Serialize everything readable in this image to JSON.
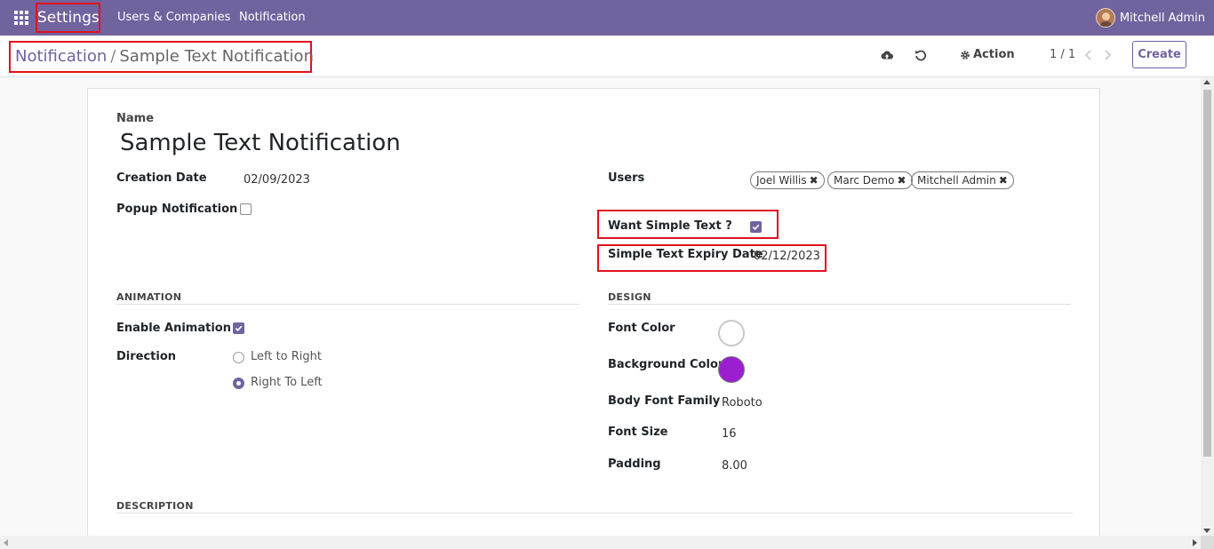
{
  "navbar": {
    "brand": "Settings",
    "menu": [
      "Users & Companies",
      "Notification"
    ],
    "user_name": "Mitchell Admin"
  },
  "breadcrumb": {
    "parent": "Notification",
    "separator": "/",
    "current": "Sample Text Notification"
  },
  "control_panel": {
    "action_label": "Action",
    "pager": "1 / 1",
    "create_label": "Create"
  },
  "form": {
    "name_label": "Name",
    "name_value": "Sample Text Notification",
    "creation_date_label": "Creation Date",
    "creation_date_value": "02/09/2023",
    "popup_label": "Popup Notification ?",
    "popup_checked": false,
    "users_label": "Users",
    "users": [
      "Joel Willis",
      "Marc Demo",
      "Mitchell Admin"
    ],
    "want_simple_text_label": "Want Simple Text ?",
    "want_simple_text_checked": true,
    "simple_text_expiry_label": "Simple Text Expiry Date",
    "simple_text_expiry_value": "02/12/2023"
  },
  "animation": {
    "section_title": "ANIMATION",
    "enable_label": "Enable Animation ?",
    "enable_checked": true,
    "direction_label": "Direction",
    "options": [
      "Left to Right",
      "Right To Left"
    ],
    "selected": "Right To Left"
  },
  "design": {
    "section_title": "DESIGN",
    "font_color_label": "Font Color",
    "font_color": "#ffffff",
    "background_color_label": "Background Color",
    "background_color": "#9b1fd1",
    "body_font_family_label": "Body Font Family",
    "body_font_family_value": "Roboto",
    "font_size_label": "Font Size",
    "font_size_value": "16",
    "padding_label": "Padding",
    "padding_value": "8.00"
  },
  "description": {
    "section_title": "DESCRIPTION"
  },
  "colors": {
    "brand": "#71639e",
    "highlight": "#e0121f"
  }
}
